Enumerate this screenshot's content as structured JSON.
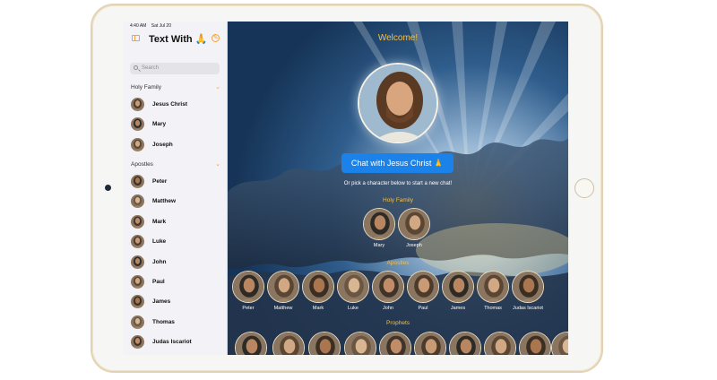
{
  "status": {
    "time": "4:40 AM",
    "date": "Sat Jul 20"
  },
  "sidebar": {
    "title": "Text With 🙏",
    "search_placeholder": "Search",
    "sections": [
      {
        "title": "Holy Family",
        "items": [
          {
            "name": "Jesus Christ"
          },
          {
            "name": "Mary"
          },
          {
            "name": "Joseph"
          }
        ]
      },
      {
        "title": "Apostles",
        "items": [
          {
            "name": "Peter"
          },
          {
            "name": "Matthew"
          },
          {
            "name": "Mark"
          },
          {
            "name": "Luke"
          },
          {
            "name": "John"
          },
          {
            "name": "Paul"
          },
          {
            "name": "James"
          },
          {
            "name": "Thomas"
          },
          {
            "name": "Judas Iscariot"
          }
        ]
      }
    ]
  },
  "main": {
    "welcome": "Welcome!",
    "chat_button": "Chat with Jesus Christ 🙏",
    "pick_text": "Or pick a character below to start a new chat!",
    "holy_family_label": "Holy Family",
    "holy_family": [
      "Mary",
      "Joseph"
    ],
    "apostles_label": "Apostles",
    "apostles": [
      "Peter",
      "Matthew",
      "Mark",
      "Luke",
      "John",
      "Paul",
      "James",
      "Thomas",
      "Judas Iscariot"
    ],
    "prophets_label": "Prophets"
  },
  "colors": {
    "accent": "#f0a43a",
    "gold_text": "#f1c04c",
    "button_blue": "#1b82ea",
    "sidebar_bg": "#f2f2f7",
    "device_frame": "#e3d3b5"
  },
  "icons": {
    "sidebar_toggle": "sidebar-toggle-icon",
    "new_chat": "new-chat-icon",
    "search": "search-icon",
    "chevron": "chevron-down-icon"
  }
}
